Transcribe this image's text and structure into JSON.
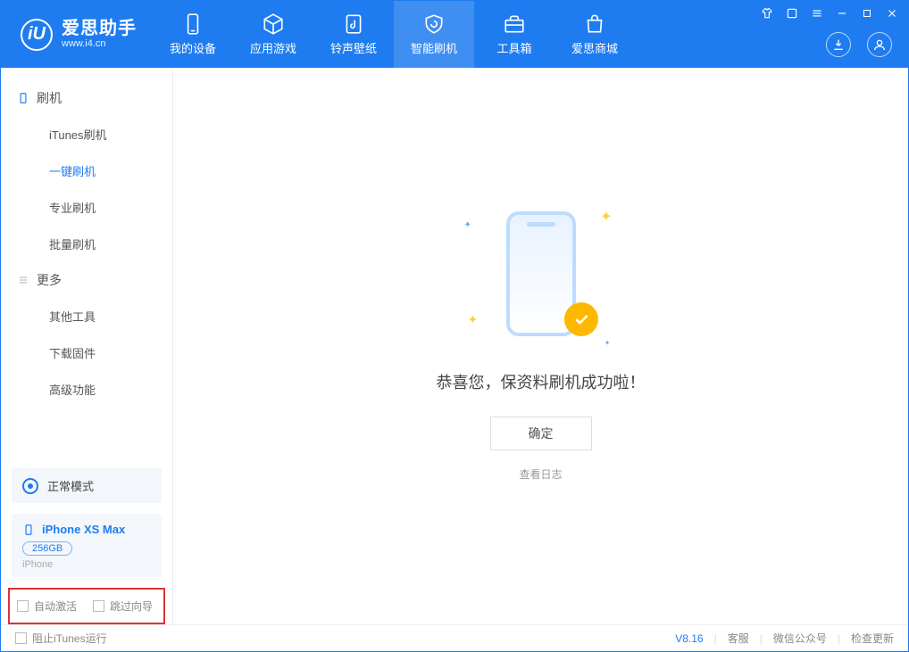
{
  "brand": {
    "name": "爱思助手",
    "url": "www.i4.cn",
    "logo_letter": "iU"
  },
  "nav": {
    "items": [
      {
        "label": "我的设备"
      },
      {
        "label": "应用游戏"
      },
      {
        "label": "铃声壁纸"
      },
      {
        "label": "智能刷机"
      },
      {
        "label": "工具箱"
      },
      {
        "label": "爱思商城"
      }
    ],
    "active_index": 3
  },
  "sidebar": {
    "groups": [
      {
        "title": "刷机",
        "items": [
          "iTunes刷机",
          "一键刷机",
          "专业刷机",
          "批量刷机"
        ],
        "active_item": 1
      },
      {
        "title": "更多",
        "items": [
          "其他工具",
          "下载固件",
          "高级功能"
        ],
        "active_item": -1
      }
    ],
    "mode_label": "正常模式",
    "device": {
      "name": "iPhone XS Max",
      "capacity": "256GB",
      "type": "iPhone"
    },
    "options": {
      "auto_activate": "自动激活",
      "skip_guide": "跳过向导"
    }
  },
  "main": {
    "success_message": "恭喜您，保资料刷机成功啦！",
    "ok_button": "确定",
    "view_log": "查看日志"
  },
  "footer": {
    "block_itunes": "阻止iTunes运行",
    "version": "V8.16",
    "links": [
      "客服",
      "微信公众号",
      "检查更新"
    ]
  }
}
